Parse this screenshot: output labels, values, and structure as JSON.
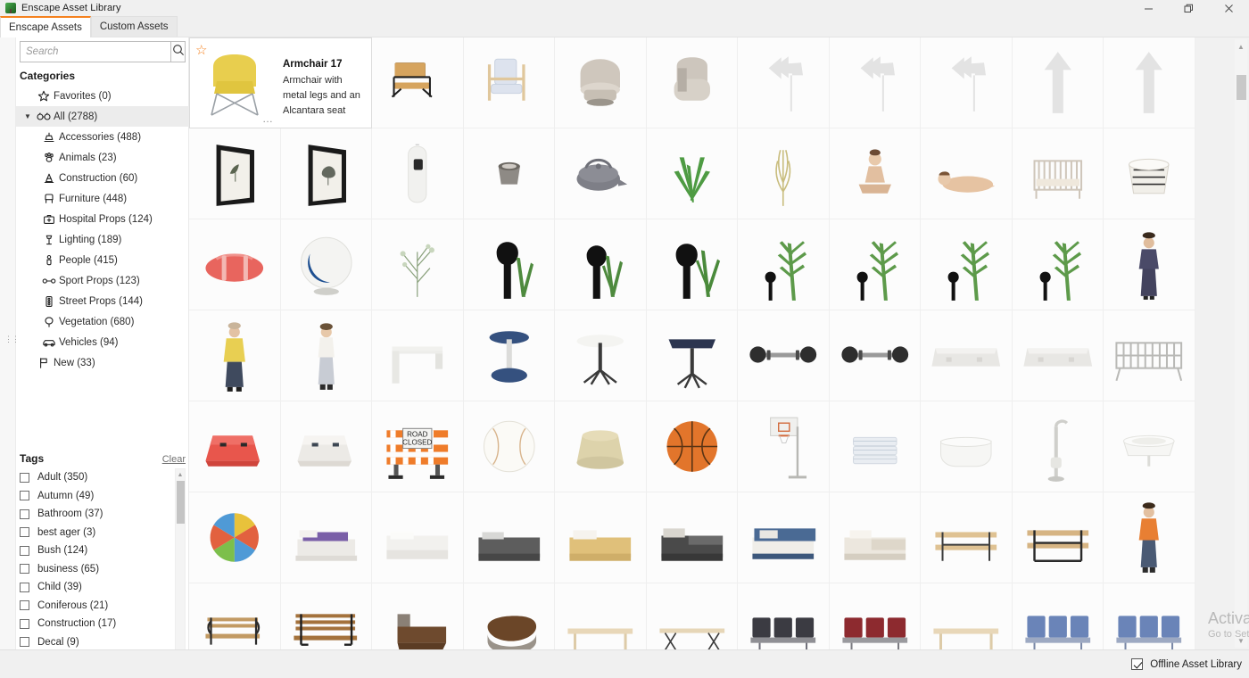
{
  "window": {
    "title": "Enscape Asset Library",
    "icon": "tree-icon",
    "controls": [
      {
        "name": "minimize-button",
        "glyph": "minimize-icon"
      },
      {
        "name": "restore-button",
        "glyph": "restore-icon"
      },
      {
        "name": "close-button",
        "glyph": "close-icon"
      }
    ]
  },
  "tabs": [
    {
      "label": "Enscape Assets",
      "active": true
    },
    {
      "label": "Custom Assets",
      "active": false
    }
  ],
  "search": {
    "value": "",
    "placeholder": "Search",
    "icon": "search-icon"
  },
  "sidebar": {
    "categories_title": "Categories",
    "categories": [
      {
        "label": "Favorites (0)",
        "icon": "star-icon",
        "level": 0,
        "selected": false,
        "caret": ""
      },
      {
        "label": "All (2788)",
        "icon": "glasses-icon",
        "level": 0,
        "selected": true,
        "caret": "▼"
      },
      {
        "label": "Accessories (488)",
        "icon": "lamp-icon",
        "level": 1,
        "selected": false,
        "caret": ""
      },
      {
        "label": "Animals (23)",
        "icon": "paw-icon",
        "level": 1,
        "selected": false,
        "caret": ""
      },
      {
        "label": "Construction (60)",
        "icon": "cone-icon",
        "level": 1,
        "selected": false,
        "caret": ""
      },
      {
        "label": "Furniture (448)",
        "icon": "chair-icon",
        "level": 1,
        "selected": false,
        "caret": ""
      },
      {
        "label": "Hospital Props (124)",
        "icon": "first-aid-icon",
        "level": 1,
        "selected": false,
        "caret": ""
      },
      {
        "label": "Lighting (189)",
        "icon": "floor-lamp-icon",
        "level": 1,
        "selected": false,
        "caret": ""
      },
      {
        "label": "People (415)",
        "icon": "person-icon",
        "level": 1,
        "selected": false,
        "caret": ""
      },
      {
        "label": "Sport Props (123)",
        "icon": "dumbbell-icon",
        "level": 1,
        "selected": false,
        "caret": ""
      },
      {
        "label": "Street Props (144)",
        "icon": "traffic-light-icon",
        "level": 1,
        "selected": false,
        "caret": ""
      },
      {
        "label": "Vegetation (680)",
        "icon": "tree-icon",
        "level": 1,
        "selected": false,
        "caret": ""
      },
      {
        "label": "Vehicles (94)",
        "icon": "car-icon",
        "level": 1,
        "selected": false,
        "caret": ""
      },
      {
        "label": "New (33)",
        "icon": "flag-icon",
        "level": 0,
        "selected": false,
        "caret": ""
      }
    ],
    "tags_title": "Tags",
    "tags_clear_label": "Clear",
    "tags": [
      {
        "label": "Adult (350)",
        "checked": false
      },
      {
        "label": "Autumn (49)",
        "checked": false
      },
      {
        "label": "Bathroom (37)",
        "checked": false
      },
      {
        "label": "best ager (3)",
        "checked": false
      },
      {
        "label": "Bush (124)",
        "checked": false
      },
      {
        "label": "business (65)",
        "checked": false
      },
      {
        "label": "Child (39)",
        "checked": false
      },
      {
        "label": "Coniferous (21)",
        "checked": false
      },
      {
        "label": "Construction (17)",
        "checked": false
      },
      {
        "label": "Decal (9)",
        "checked": false
      }
    ]
  },
  "selected_asset": {
    "name": "Armchair 17",
    "description": "Armchair with metal legs and an Alcantara seat",
    "favorite_icon": "star-icon",
    "more_icon": "ellipsis-icon",
    "thumb": "armchair-yellow"
  },
  "grid": {
    "columns": 11,
    "items": [
      {
        "art": "armchair-leather-black",
        "name": "asset-thumb-armchair-leather"
      },
      {
        "art": "armchair-wood-blue",
        "name": "asset-thumb-armchair-wood"
      },
      {
        "art": "tub-chair-beige",
        "name": "asset-thumb-tub-chair"
      },
      {
        "art": "lounge-chair-grey",
        "name": "asset-thumb-lounge-chair"
      },
      {
        "art": "arrow-left-turn",
        "name": "asset-thumb-arrow-decal-1"
      },
      {
        "art": "arrow-left-turn",
        "name": "asset-thumb-arrow-decal-2"
      },
      {
        "art": "arrow-left-turn",
        "name": "asset-thumb-arrow-decal-3"
      },
      {
        "art": "arrow-straight",
        "name": "asset-thumb-arrow-decal-4"
      },
      {
        "art": "arrow-straight",
        "name": "asset-thumb-arrow-decal-5"
      },
      {
        "art": "framed-art-leaf",
        "name": "asset-thumb-frame-1"
      },
      {
        "art": "framed-art-ginkgo",
        "name": "asset-thumb-frame-2"
      },
      {
        "art": "bin-tall-white",
        "name": "asset-thumb-bin"
      },
      {
        "art": "pot-small-grey",
        "name": "asset-thumb-pot"
      },
      {
        "art": "teapot-grey",
        "name": "asset-thumb-teapot"
      },
      {
        "art": "aloe-plant",
        "name": "asset-thumb-aloe"
      },
      {
        "art": "grass-tuft",
        "name": "asset-thumb-grass"
      },
      {
        "art": "woman-sitting",
        "name": "asset-thumb-person-1"
      },
      {
        "art": "woman-lying",
        "name": "asset-thumb-person-2"
      },
      {
        "art": "crib-white",
        "name": "asset-thumb-crib"
      },
      {
        "art": "basket-pattern",
        "name": "asset-thumb-basket"
      },
      {
        "art": "sleeping-bag-red",
        "name": "asset-thumb-sleeping-bag"
      },
      {
        "art": "ball-chair-blue",
        "name": "asset-thumb-ball-chair"
      },
      {
        "art": "thin-branches",
        "name": "asset-thumb-branches"
      },
      {
        "art": "silhouette-plant-1",
        "name": "asset-thumb-silhouette-1"
      },
      {
        "art": "silhouette-plant-2",
        "name": "asset-thumb-silhouette-2"
      },
      {
        "art": "silhouette-plant-3",
        "name": "asset-thumb-silhouette-3"
      },
      {
        "art": "tall-tree-scale",
        "name": "asset-thumb-tree-1"
      },
      {
        "art": "tall-tree-scale",
        "name": "asset-thumb-tree-2"
      },
      {
        "art": "tall-tree-scale",
        "name": "asset-thumb-tree-3"
      },
      {
        "art": "tall-tree-scale",
        "name": "asset-thumb-tree-4"
      },
      {
        "art": "woman-suit",
        "name": "asset-thumb-person-3"
      },
      {
        "art": "woman-coat-yellow",
        "name": "asset-thumb-person-4"
      },
      {
        "art": "woman-casual",
        "name": "asset-thumb-person-5"
      },
      {
        "art": "desk-white",
        "name": "asset-thumb-desk"
      },
      {
        "art": "bar-table-blue",
        "name": "asset-thumb-bar-table"
      },
      {
        "art": "round-table-white",
        "name": "asset-thumb-round-table"
      },
      {
        "art": "square-table-dark",
        "name": "asset-thumb-square-table"
      },
      {
        "art": "barbell",
        "name": "asset-thumb-barbell-1"
      },
      {
        "art": "barbell",
        "name": "asset-thumb-barbell-2"
      },
      {
        "art": "concrete-barrier",
        "name": "asset-thumb-barrier-1"
      },
      {
        "art": "concrete-barrier",
        "name": "asset-thumb-barrier-2"
      },
      {
        "art": "crowd-fence",
        "name": "asset-thumb-crowd-fence"
      },
      {
        "art": "barrier-red",
        "name": "asset-thumb-barrier-red"
      },
      {
        "art": "barrier-white",
        "name": "asset-thumb-barrier-white"
      },
      {
        "art": "road-closed-sign",
        "name": "asset-thumb-road-closed"
      },
      {
        "art": "baseball",
        "name": "asset-thumb-baseball"
      },
      {
        "art": "pouf-beige",
        "name": "asset-thumb-pouf"
      },
      {
        "art": "basketball",
        "name": "asset-thumb-basketball"
      },
      {
        "art": "basketball-hoop",
        "name": "asset-thumb-hoop"
      },
      {
        "art": "towels-stack",
        "name": "asset-thumb-towels"
      },
      {
        "art": "bathtub-white",
        "name": "asset-thumb-bathtub"
      },
      {
        "art": "faucet-standing",
        "name": "asset-thumb-faucet"
      },
      {
        "art": "sink-white",
        "name": "asset-thumb-sink"
      },
      {
        "art": "beach-ball",
        "name": "asset-thumb-beach-ball"
      },
      {
        "art": "bed-purple",
        "name": "asset-thumb-bed-1"
      },
      {
        "art": "bed-white",
        "name": "asset-thumb-bed-2"
      },
      {
        "art": "bed-grey",
        "name": "asset-thumb-bed-3"
      },
      {
        "art": "bed-yellow",
        "name": "asset-thumb-bed-4"
      },
      {
        "art": "bed-dark",
        "name": "asset-thumb-bed-5"
      },
      {
        "art": "bed-blue",
        "name": "asset-thumb-bed-6"
      },
      {
        "art": "bed-beige",
        "name": "asset-thumb-bed-7"
      },
      {
        "art": "picnic-bench-light",
        "name": "asset-thumb-bench-1"
      },
      {
        "art": "picnic-bench-dark",
        "name": "asset-thumb-bench-2"
      },
      {
        "art": "man-orange-vest",
        "name": "asset-thumb-person-6"
      },
      {
        "art": "park-bench-iron",
        "name": "asset-thumb-bench-3"
      },
      {
        "art": "park-bench-wood",
        "name": "asset-thumb-bench-4"
      },
      {
        "art": "daybed-wood",
        "name": "asset-thumb-daybed-1"
      },
      {
        "art": "daybed-round",
        "name": "asset-thumb-daybed-2"
      },
      {
        "art": "bench-plain-light",
        "name": "asset-thumb-bench-5"
      },
      {
        "art": "bench-wire",
        "name": "asset-thumb-bench-6"
      },
      {
        "art": "airport-seats-dark",
        "name": "asset-thumb-seats-1"
      },
      {
        "art": "airport-seats-red",
        "name": "asset-thumb-seats-2"
      },
      {
        "art": "bench-plain-light",
        "name": "asset-thumb-bench-7"
      },
      {
        "art": "airport-seats-blue",
        "name": "asset-thumb-seats-3"
      },
      {
        "art": "airport-seats-blue",
        "name": "asset-thumb-seats-4"
      }
    ],
    "scroll_up_icon": "chevron-up-icon",
    "scroll_down_icon": "chevron-down-icon"
  },
  "statusbar": {
    "offline_label": "Offline Asset Library",
    "offline_checked": true
  },
  "watermark": {
    "line1": "Activate Windows",
    "line2": "Go to Settings to activate Windows."
  }
}
